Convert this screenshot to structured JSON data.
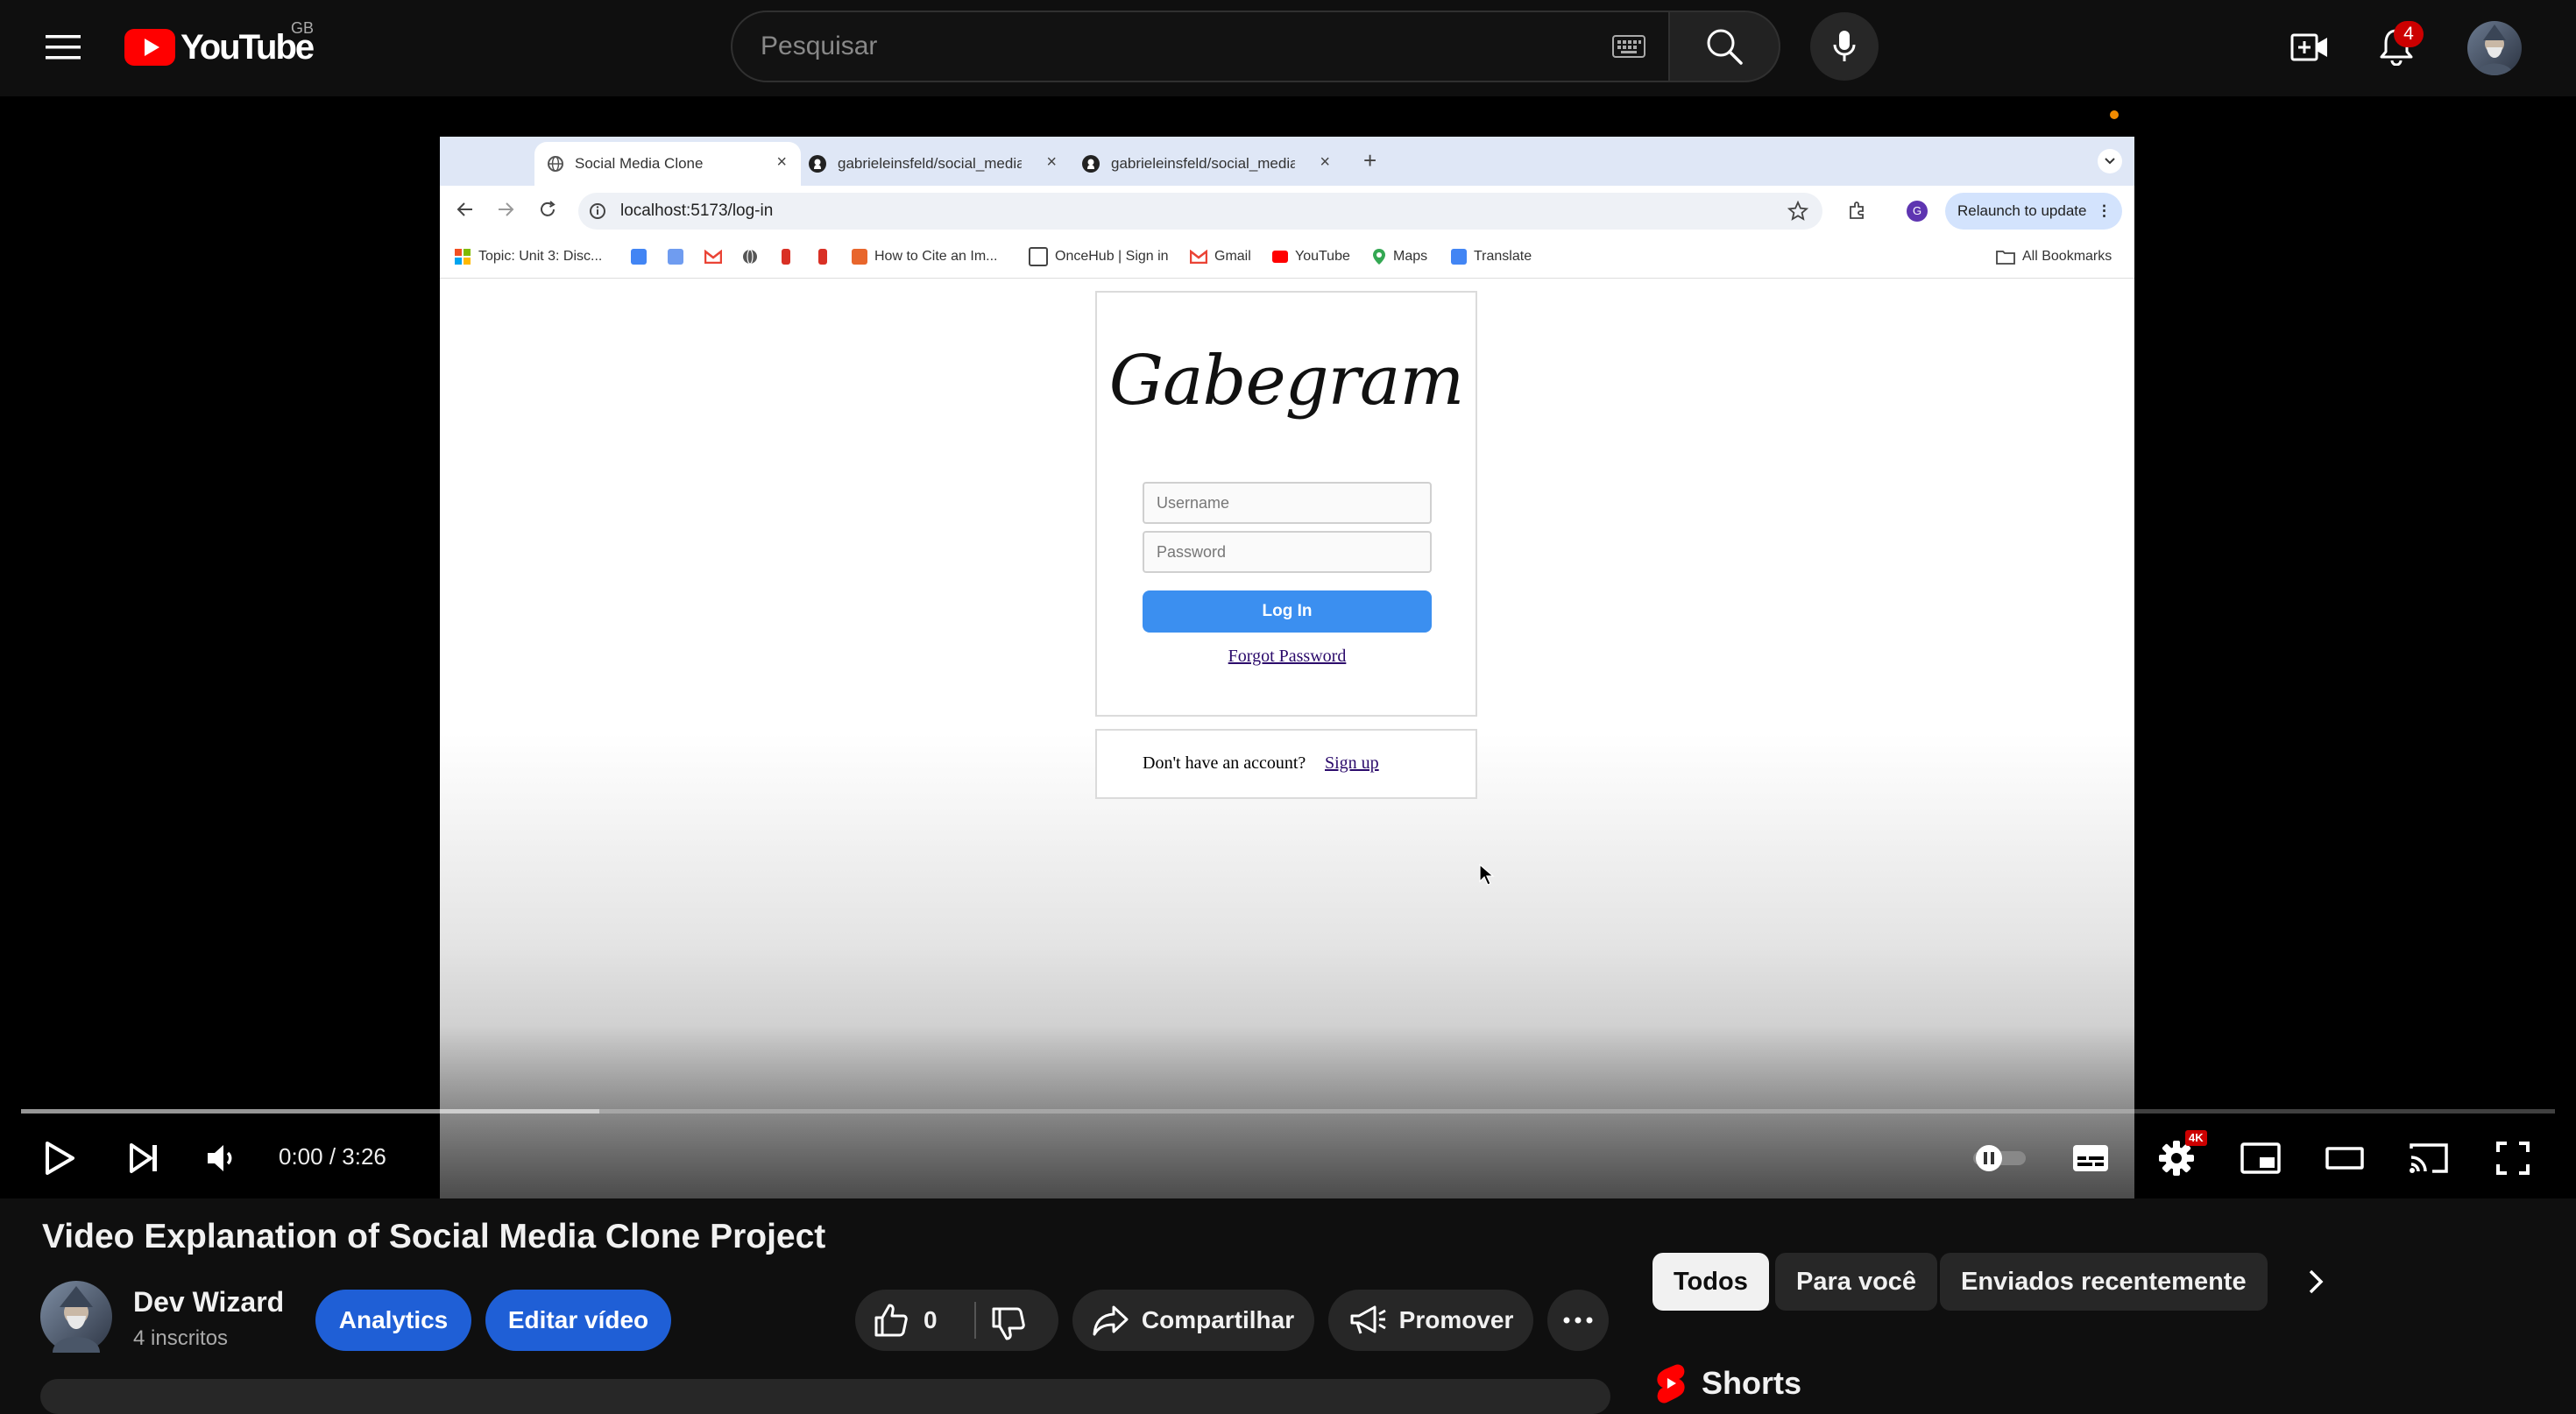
{
  "youtube": {
    "logo_text": "YouTube",
    "country_code": "GB",
    "search_placeholder": "Pesquisar",
    "notifications_count": "4"
  },
  "browser": {
    "tabs": [
      {
        "label": "Social Media Clone",
        "active": true
      },
      {
        "label": "gabrieleinsfeld/social_media_",
        "active": false
      },
      {
        "label": "gabrieleinsfeld/social_media_",
        "active": false
      }
    ],
    "url": "localhost:5173/log-in",
    "relaunch_label": "Relaunch to update",
    "profile_initial": "G",
    "bookmarks": {
      "topic": "Topic: Unit 3: Disc...",
      "cite": "How to Cite an Im...",
      "oncehub": "OnceHub | Sign in",
      "gmail": "Gmail",
      "youtube": "YouTube",
      "maps": "Maps",
      "translate": "Translate",
      "all": "All Bookmarks"
    }
  },
  "app_page": {
    "brand": "Gabegram",
    "username_placeholder": "Username",
    "password_placeholder": "Password",
    "login_label": "Log In",
    "forgot_label": "Forgot Password",
    "no_account_text": "Don't have an account?",
    "signup_label": "Sign up"
  },
  "player": {
    "time": "0:00 / 3:26",
    "settings_badge": "4K",
    "progress": 0.0
  },
  "video": {
    "title": "Video Explanation of Social Media Clone Project",
    "channel_name": "Dev Wizard",
    "subscribers": "4 inscritos",
    "analytics_label": "Analytics",
    "edit_label": "Editar vídeo",
    "like_count": "0",
    "share_label": "Compartilhar",
    "promote_label": "Promover"
  },
  "sidebar": {
    "chips": [
      "Todos",
      "Para você",
      "Enviados recentemente"
    ],
    "shorts_label": "Shorts"
  },
  "colors": {
    "accent_red": "#ff0000",
    "button_blue": "#1f5fd6",
    "login_blue": "#3b8ff0"
  }
}
